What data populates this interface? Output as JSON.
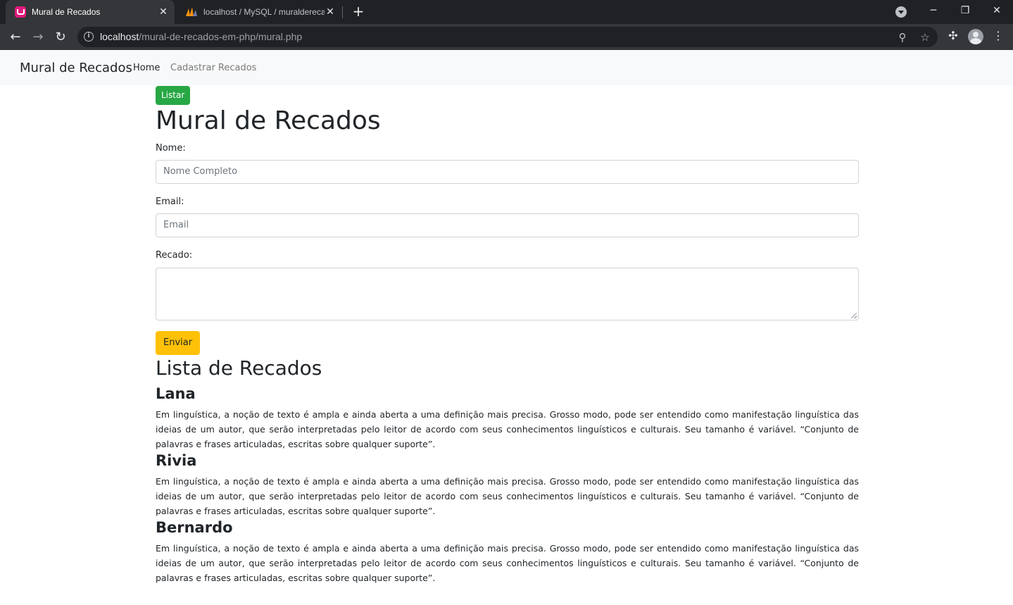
{
  "browser": {
    "tabs": [
      {
        "title": "Mural de Recados",
        "favicon": "mural-favicon-icon"
      },
      {
        "title": "localhost / MySQL / muralderecados",
        "favicon": "phpmyadmin-favicon-icon"
      }
    ],
    "url_host": "localhost",
    "url_path": "/mural-de-recados-em-php/mural.php"
  },
  "navbar": {
    "brand": "Mural de Recados",
    "links": [
      "Home",
      "Cadastrar Recados"
    ]
  },
  "page": {
    "list_button": "Listar",
    "title": "Mural de Recados",
    "form": {
      "name_label": "Nome:",
      "name_placeholder": "Nome Completo",
      "email_label": "Email:",
      "email_placeholder": "Email",
      "message_label": "Recado:",
      "submit_label": "Enviar"
    },
    "list_title": "Lista de Recados",
    "recados": [
      {
        "nome": "Lana",
        "texto": "Em linguística, a noção de texto é ampla e ainda aberta a uma definição mais precisa. Grosso modo, pode ser entendido como manifestação linguística das ideias de um autor, que serão interpretadas pelo leitor de acordo com seus conhecimentos linguísticos e culturais. Seu tamanho é variável. “Conjunto de palavras e frases articuladas, escritas sobre qualquer suporte”."
      },
      {
        "nome": "Rivia",
        "texto": "Em linguística, a noção de texto é ampla e ainda aberta a uma definição mais precisa. Grosso modo, pode ser entendido como manifestação linguística das ideias de um autor, que serão interpretadas pelo leitor de acordo com seus conhecimentos linguísticos e culturais. Seu tamanho é variável. “Conjunto de palavras e frases articuladas, escritas sobre qualquer suporte”."
      },
      {
        "nome": "Bernardo",
        "texto": "Em linguística, a noção de texto é ampla e ainda aberta a uma definição mais precisa. Grosso modo, pode ser entendido como manifestação linguística das ideias de um autor, que serão interpretadas pelo leitor de acordo com seus conhecimentos linguísticos e culturais. Seu tamanho é variável. “Conjunto de palavras e frases articuladas, escritas sobre qualquer suporte”."
      }
    ]
  },
  "colors": {
    "success": "#28a745",
    "warning": "#ffc107",
    "navbar_bg": "#f8f9fa"
  }
}
